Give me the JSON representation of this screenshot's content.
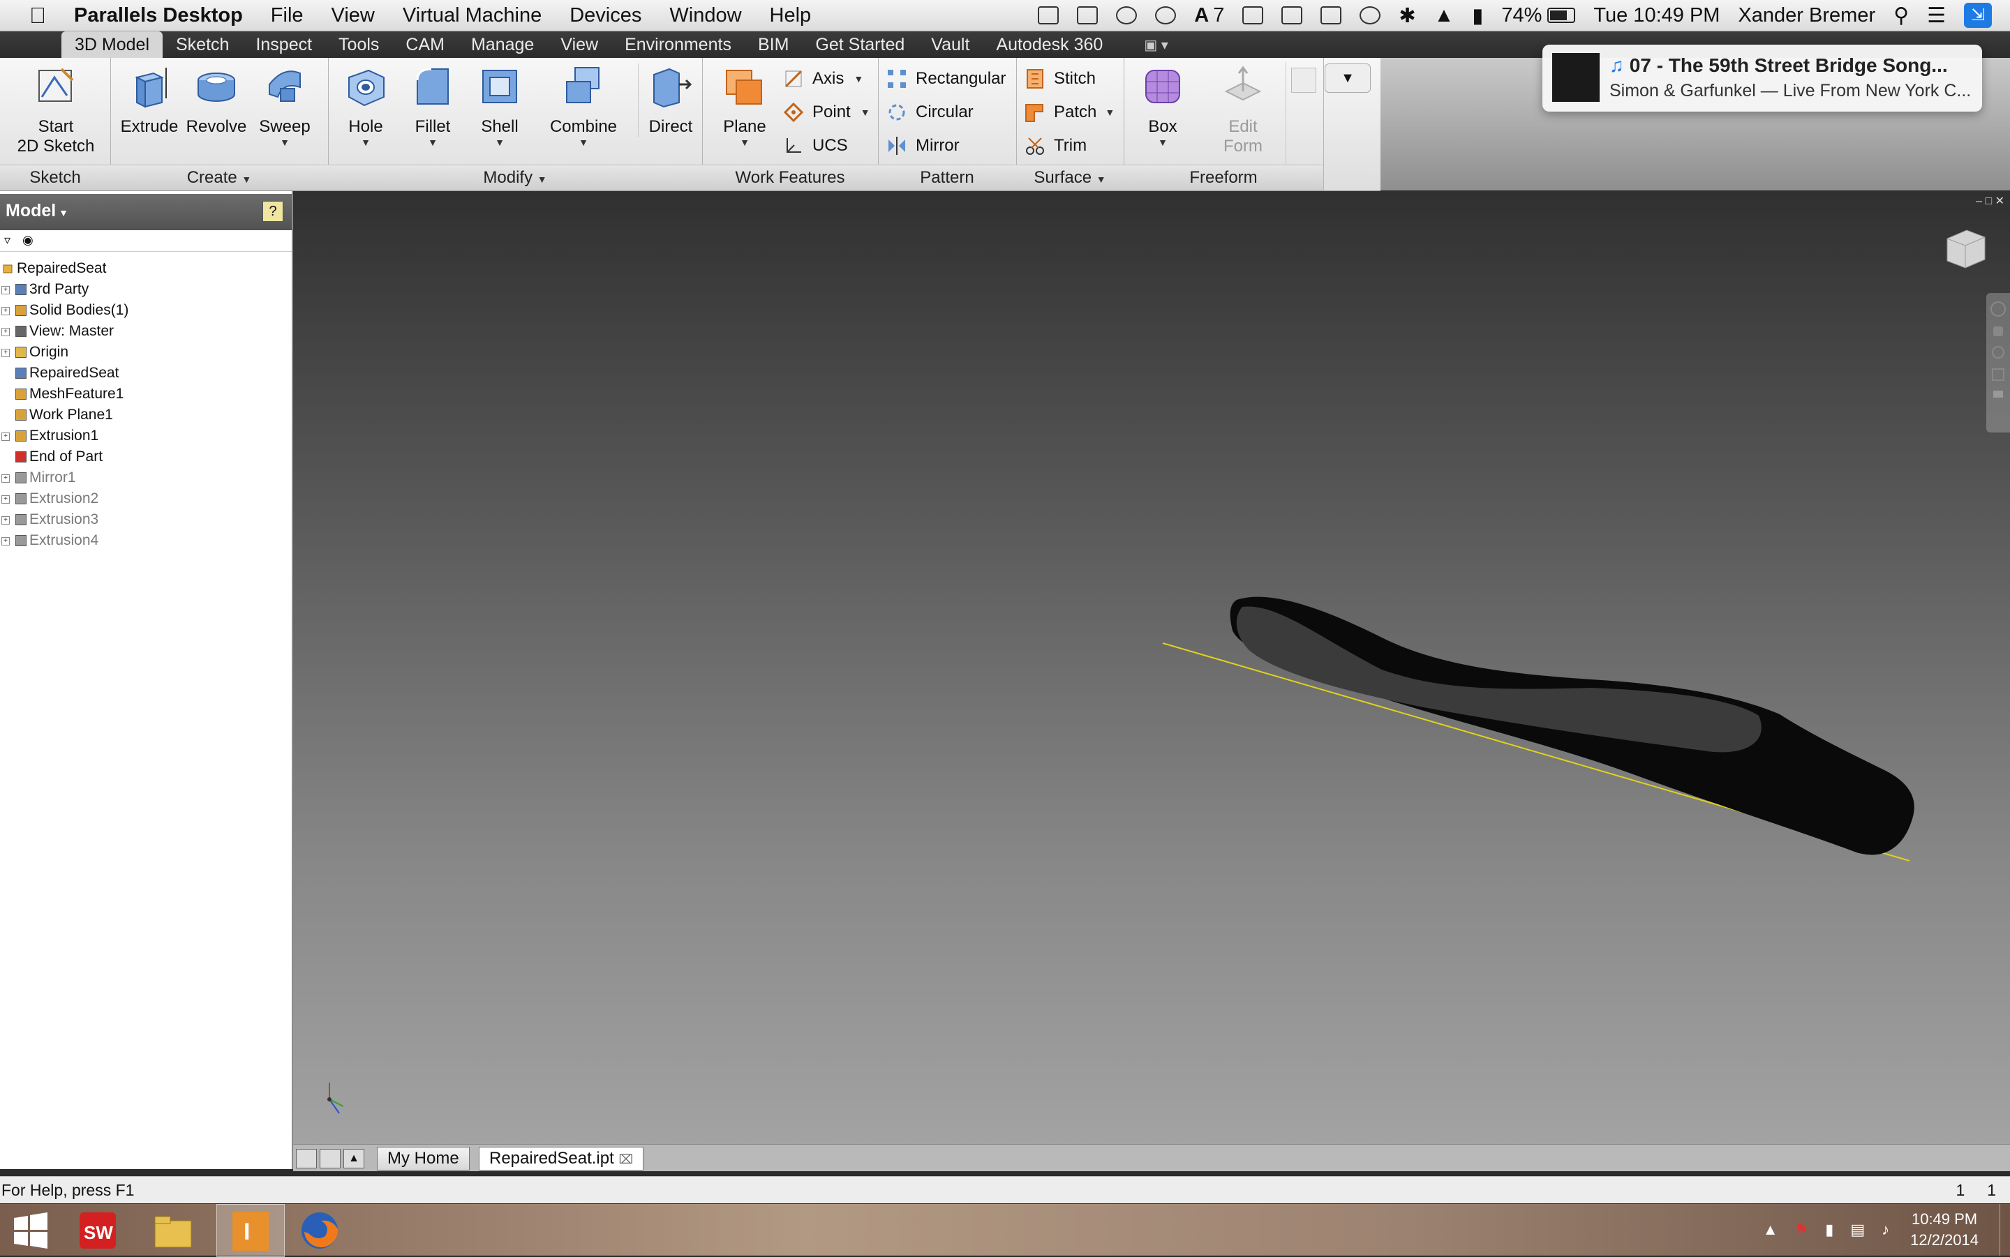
{
  "menubar": {
    "app_name": "Parallels Desktop",
    "items": [
      "File",
      "View",
      "Virtual Machine",
      "Devices",
      "Window",
      "Help"
    ],
    "status": {
      "adobe_count": "7",
      "battery": "74%",
      "datetime": "Tue 10:49 PM",
      "user": "Xander Bremer"
    }
  },
  "ribbon": {
    "tabs": [
      "3D Model",
      "Sketch",
      "Inspect",
      "Tools",
      "CAM",
      "Manage",
      "View",
      "Environments",
      "BIM",
      "Get Started",
      "Vault",
      "Autodesk 360"
    ],
    "active_tab": "3D Model",
    "panels": {
      "sketch": {
        "title": "Sketch",
        "start_line1": "Start",
        "start_line2": "2D Sketch"
      },
      "create": {
        "title": "Create",
        "buttons": [
          "Extrude",
          "Revolve",
          "Sweep"
        ]
      },
      "modify": {
        "title": "Modify",
        "buttons": [
          "Hole",
          "Fillet",
          "Shell",
          "Combine",
          "Direct"
        ]
      },
      "work_features": {
        "title": "Work Features",
        "plane": "Plane",
        "axis": "Axis",
        "point": "Point",
        "ucs": "UCS"
      },
      "pattern": {
        "title": "Pattern",
        "rectangular": "Rectangular",
        "circular": "Circular",
        "mirror": "Mirror"
      },
      "surface": {
        "title": "Surface",
        "stitch": "Stitch",
        "patch": "Patch",
        "trim": "Trim"
      },
      "freeform": {
        "title": "Freeform",
        "box": "Box",
        "edit_line1": "Edit",
        "edit_line2": "Form"
      }
    }
  },
  "notification": {
    "title": "07 - The 59th Street Bridge Song...",
    "subtitle": "Simon & Garfunkel — Live From New York C..."
  },
  "browser": {
    "title": "Model",
    "root": "RepairedSeat",
    "nodes": [
      {
        "label": "3rd Party",
        "expandable": true,
        "dim": false,
        "icon_color": "#5b7fb8"
      },
      {
        "label": "Solid Bodies(1)",
        "expandable": true,
        "dim": false,
        "icon_color": "#d8a23a"
      },
      {
        "label": "View: Master",
        "expandable": true,
        "dim": false,
        "icon_color": "#666666"
      },
      {
        "label": "Origin",
        "expandable": true,
        "dim": false,
        "icon_color": "#e3b64a"
      },
      {
        "label": "RepairedSeat",
        "expandable": false,
        "dim": false,
        "icon_color": "#5b7fb8"
      },
      {
        "label": "MeshFeature1",
        "expandable": false,
        "dim": false,
        "icon_color": "#d8a23a"
      },
      {
        "label": "Work Plane1",
        "expandable": false,
        "dim": false,
        "icon_color": "#d8a23a"
      },
      {
        "label": "Extrusion1",
        "expandable": true,
        "dim": false,
        "icon_color": "#d8a23a"
      },
      {
        "label": "End of Part",
        "expandable": false,
        "dim": false,
        "icon_color": "#d0302a"
      },
      {
        "label": "Mirror1",
        "expandable": true,
        "dim": true,
        "icon_color": "#999999"
      },
      {
        "label": "Extrusion2",
        "expandable": true,
        "dim": true,
        "icon_color": "#999999"
      },
      {
        "label": "Extrusion3",
        "expandable": true,
        "dim": true,
        "icon_color": "#999999"
      },
      {
        "label": "Extrusion4",
        "expandable": true,
        "dim": true,
        "icon_color": "#999999"
      }
    ]
  },
  "doc_tabs": {
    "home": "My Home",
    "active": "RepairedSeat.ipt"
  },
  "status_bar": {
    "help": "For Help, press F1",
    "count_a": "1",
    "count_b": "1"
  },
  "taskbar": {
    "time": "10:49 PM",
    "date": "12/2/2014"
  },
  "colors": {
    "workplane_line": "#e0d21a",
    "accent_blue": "#1e7be4",
    "model_body": "#0a0a0a"
  }
}
